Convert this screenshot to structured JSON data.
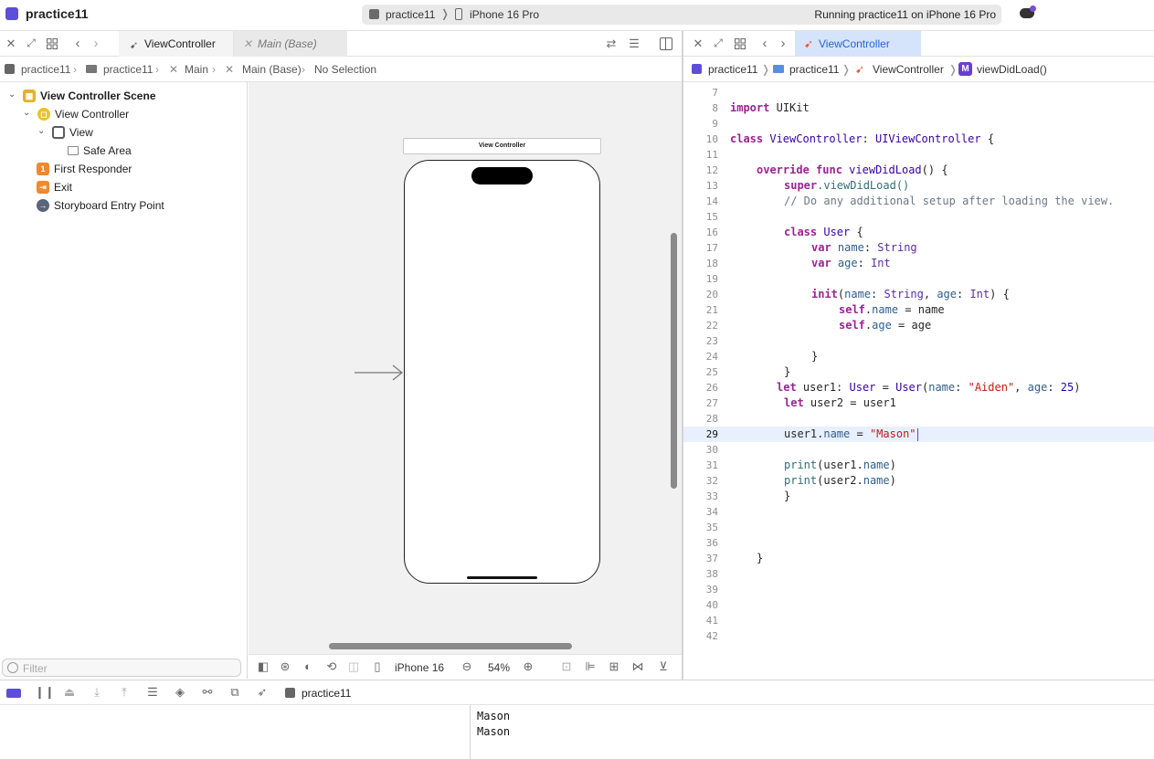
{
  "window": {
    "title": "practice11",
    "scheme": "practice11",
    "device": "iPhone 16 Pro",
    "run_status": "Running practice11 on iPhone 16 Pro"
  },
  "left_editor": {
    "tabs": [
      {
        "label": "ViewController"
      },
      {
        "label": "Main (Base)"
      }
    ],
    "breadcrumb": [
      "practice11",
      "practice11",
      "Main",
      "Main (Base)",
      "No Selection"
    ]
  },
  "outline": {
    "items": [
      {
        "label": "View Controller Scene",
        "icon": "scene-icon"
      },
      {
        "label": "View Controller",
        "icon": "view-controller-icon"
      },
      {
        "label": "View",
        "icon": "view-icon"
      },
      {
        "label": "Safe Area",
        "icon": "safe-area-icon"
      },
      {
        "label": "First Responder",
        "icon": "first-responder-icon",
        "badge": "1"
      },
      {
        "label": "Exit",
        "icon": "exit-icon"
      },
      {
        "label": "Storyboard Entry Point",
        "icon": "entry-point-icon"
      }
    ],
    "filter_placeholder": "Filter"
  },
  "canvas": {
    "scene_title": "View Controller",
    "device_label": "iPhone 16",
    "zoom": "54%"
  },
  "right_editor": {
    "tab": {
      "label": "ViewController"
    },
    "breadcrumb": [
      "practice11",
      "practice11",
      "ViewController",
      "viewDidLoad()"
    ],
    "method_badge": "M",
    "active_line": 29
  },
  "code_lines": [
    {
      "n": "7"
    },
    {
      "n": "8"
    },
    {
      "n": "9"
    },
    {
      "n": "10"
    },
    {
      "n": "11"
    },
    {
      "n": "12"
    },
    {
      "n": "13"
    },
    {
      "n": "14"
    },
    {
      "n": "15"
    },
    {
      "n": "16"
    },
    {
      "n": "17"
    },
    {
      "n": "18"
    },
    {
      "n": "19"
    },
    {
      "n": "20"
    },
    {
      "n": "21"
    },
    {
      "n": "22"
    },
    {
      "n": "23"
    },
    {
      "n": "24"
    },
    {
      "n": "25"
    },
    {
      "n": "26"
    },
    {
      "n": "27"
    },
    {
      "n": "28"
    },
    {
      "n": "29"
    },
    {
      "n": "30"
    },
    {
      "n": "31"
    },
    {
      "n": "32"
    },
    {
      "n": "33"
    },
    {
      "n": "34"
    },
    {
      "n": "35"
    },
    {
      "n": "36"
    },
    {
      "n": "37"
    },
    {
      "n": "38"
    },
    {
      "n": "39"
    },
    {
      "n": "40"
    },
    {
      "n": "41"
    },
    {
      "n": "42"
    }
  ],
  "code_text": {
    "import": "import",
    "uikit": "UIKit",
    "class_kw": "class",
    "vc_name": "ViewController",
    "colon": ":",
    "superclass": "UIViewController",
    "open_brace": "{",
    "close_brace": "}",
    "override": "override",
    "func": "func",
    "viewDidLoad": "viewDidLoad",
    "parens_brace": "() {",
    "super": "super",
    "super_call": ".viewDidLoad()",
    "comment": "// Do any additional setup after loading the view.",
    "user": "User",
    "var": "var",
    "name": "name",
    "age": "age",
    "string": "String",
    "int": "Int",
    "init": "init",
    "self": "self",
    "let": "let",
    "user1": "user1",
    "user2": "user2",
    "aiden": "\"Aiden\"",
    "mason": "\"Mason\"",
    "num25": "25",
    "print": "print"
  },
  "console": {
    "scheme": "practice11",
    "output": [
      "Mason",
      "Mason"
    ]
  },
  "colors": {
    "accent": "#2a63d4",
    "keyword": "#9b2393",
    "string": "#c41a16",
    "number": "#1c00cf"
  }
}
